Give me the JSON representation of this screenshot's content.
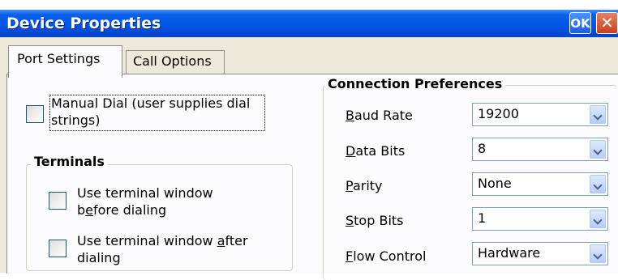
{
  "window": {
    "title": "Device Properties",
    "ok_label": "OK",
    "close_label": "✕"
  },
  "tabs": [
    {
      "label": "Port Settings",
      "selected": true
    },
    {
      "label": "Call Options",
      "selected": false
    }
  ],
  "manual_dial": {
    "label_line1": "Manual Dial (user supplies dial",
    "label_line2": "strings)",
    "checked": false
  },
  "terminals": {
    "title": "Terminals",
    "before": {
      "line1": "Use terminal window",
      "line2_pre": "b",
      "line2_ul": "e",
      "line2_post": "fore dialing",
      "checked": false
    },
    "after": {
      "line1_pre": "Use terminal window ",
      "line1_ul": "a",
      "line1_post": "fter",
      "line2": "dialing",
      "checked": false
    }
  },
  "connection": {
    "title": "Connection Preferences",
    "fields": [
      {
        "ul": "B",
        "rest": "aud Rate",
        "value": "19200"
      },
      {
        "ul": "D",
        "rest": "ata Bits",
        "value": "8"
      },
      {
        "ul": "P",
        "rest": "arity",
        "value": "None"
      },
      {
        "ul": "S",
        "rest": "top Bits",
        "value": "1"
      },
      {
        "ul": "F",
        "rest": "low Control",
        "value": "Hardware"
      }
    ]
  }
}
